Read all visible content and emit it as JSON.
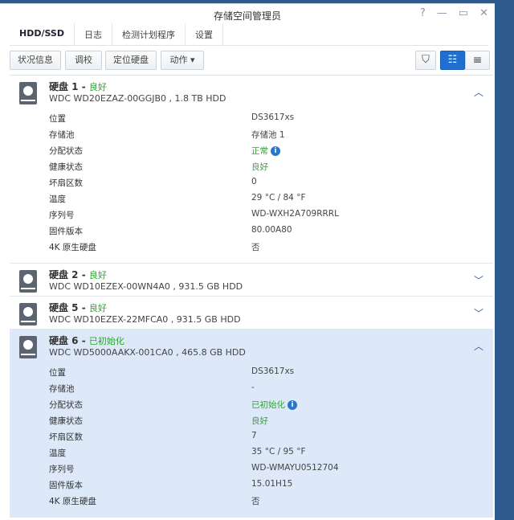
{
  "window": {
    "title": "存储空间管理员",
    "help": "?",
    "minimize": "—",
    "maximize": "▭",
    "close": "✕"
  },
  "tabs": [
    "HDD/SSD",
    "日志",
    "检测计划程序",
    "设置"
  ],
  "toolbar": {
    "status": "状况信息",
    "calibrate": "调校",
    "locate": "定位硬盘",
    "action": "动作 ▾",
    "filter": "⛉",
    "view_detail": "☷",
    "view_list": "≡"
  },
  "labels": [
    "位置",
    "存储池",
    "分配状态",
    "健康状态",
    "坏扇区数",
    "温度",
    "序列号",
    "固件版本",
    "4K 原生硬盘"
  ],
  "disks": [
    {
      "name": "硬盘 1",
      "status": "良好",
      "model": "WDC WD20EZAZ-00GGJB0 , 1.8 TB HDD",
      "expanded": true,
      "values": [
        "DS3617xs",
        "存储池 1",
        "正常",
        "良好",
        "0",
        "29 °C / 84 °F",
        "WD-WXH2A709RRRL",
        "80.00A80",
        "否"
      ]
    },
    {
      "name": "硬盘 2",
      "status": "良好",
      "model": "WDC WD10EZEX-00WN4A0 , 931.5 GB HDD",
      "expanded": false
    },
    {
      "name": "硬盘 5",
      "status": "良好",
      "model": "WDC WD10EZEX-22MFCA0 , 931.5 GB HDD",
      "expanded": false
    },
    {
      "name": "硬盘 6",
      "status": "已初始化",
      "model": "WDC WD5000AAKX-001CA0 , 465.8 GB HDD",
      "expanded": true,
      "values": [
        "DS3617xs",
        "-",
        "已初始化",
        "良好",
        "7",
        "35 °C / 95 °F",
        "WD-WMAYU0512704",
        "15.01H15",
        "否"
      ]
    }
  ],
  "colors": {
    "accent": "#2a77c9",
    "good": "#2ba82b",
    "selected": "#dde9f8"
  }
}
